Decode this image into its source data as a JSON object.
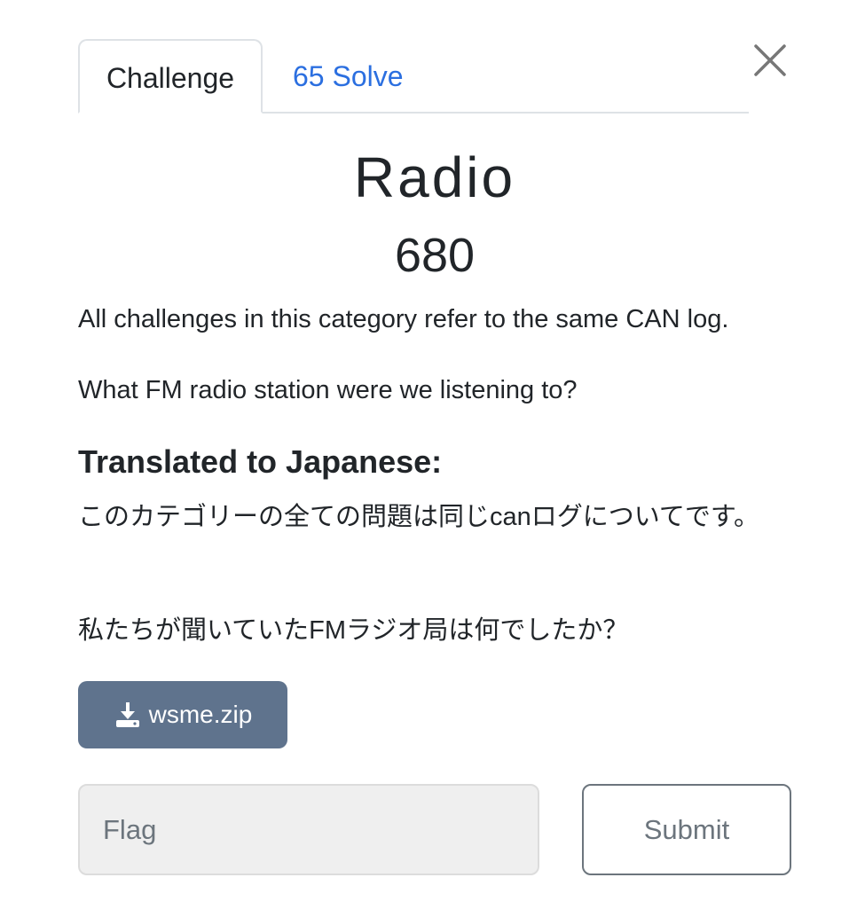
{
  "tabs": {
    "active_label": "Challenge",
    "solves_label": "65 Solve"
  },
  "challenge": {
    "name": "Radio",
    "points": "680",
    "description_en_1": "All challenges in this category refer to the same CAN log.",
    "description_en_2": "What FM radio station were we listening to?",
    "translation_heading": "Translated to Japanese:",
    "description_jp_1": "このカテゴリーの全ての問題は同じcanログについてです。",
    "description_jp_2": "私たちが聞いていたFMラジオ局は何でしたか？"
  },
  "attachment": {
    "filename": "wsme.zip",
    "icon": "download-icon"
  },
  "form": {
    "flag_placeholder": "Flag",
    "flag_value": "",
    "submit_label": "Submit"
  },
  "colors": {
    "tab_link": "#2b6fe0",
    "download_button": "#5f738d",
    "input_background": "#efefef",
    "submit_border": "#6c757d"
  }
}
